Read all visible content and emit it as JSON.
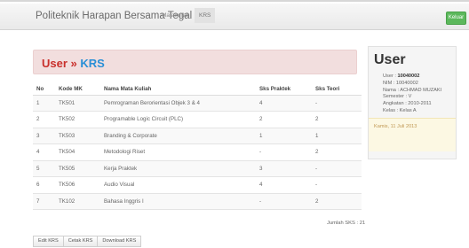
{
  "navbar": {
    "brand": "Politeknik Harapan Bersama Tegal",
    "links": [
      {
        "label": "Matakuliah",
        "active": false
      },
      {
        "label": "KRS",
        "active": true
      }
    ],
    "logout_label": "Keluar"
  },
  "page_header": {
    "root": "User",
    "separator": "»",
    "current": "KRS"
  },
  "table": {
    "headers": [
      "No",
      "Kode MK",
      "Nama Mata Kuliah",
      "Sks Praktek",
      "Sks Teori"
    ],
    "rows": [
      [
        "1",
        "TK501",
        "Pemrograman Berorientasi Objek 3 & 4",
        "4",
        "-"
      ],
      [
        "2",
        "TK502",
        "Programable Logic Circuit (PLC)",
        "2",
        "2"
      ],
      [
        "3",
        "TK503",
        "Branding & Corporate",
        "1",
        "1"
      ],
      [
        "4",
        "TK504",
        "Metodologi Riset",
        "-",
        "2"
      ],
      [
        "5",
        "TK505",
        "Kerja Praktek",
        "3",
        "-"
      ],
      [
        "6",
        "TK506",
        "Audio Visual",
        "4",
        "-"
      ],
      [
        "7",
        "TK102",
        "Bahasa Inggris I",
        "-",
        "2"
      ]
    ]
  },
  "total_sks": "Jumlah SKS : 21",
  "actions": [
    "Edit KRS",
    "Cetak KRS",
    "Download KRS"
  ],
  "sidebar": {
    "title": "User",
    "user_label": "User : ",
    "user_value": "10040002",
    "lines": [
      "NIM : 10040002",
      "Nama : ACHMAD MUZAKI",
      "Semester : V",
      "Angkatan : 2010-2011",
      "Kelas : Kelas A"
    ],
    "date": "Kamis, 11 Juli 2013"
  },
  "colors": {
    "accent": "#2a8fd6",
    "danger": "#c9302c",
    "success": "#5cb85c",
    "warning_text": "#c09853"
  }
}
